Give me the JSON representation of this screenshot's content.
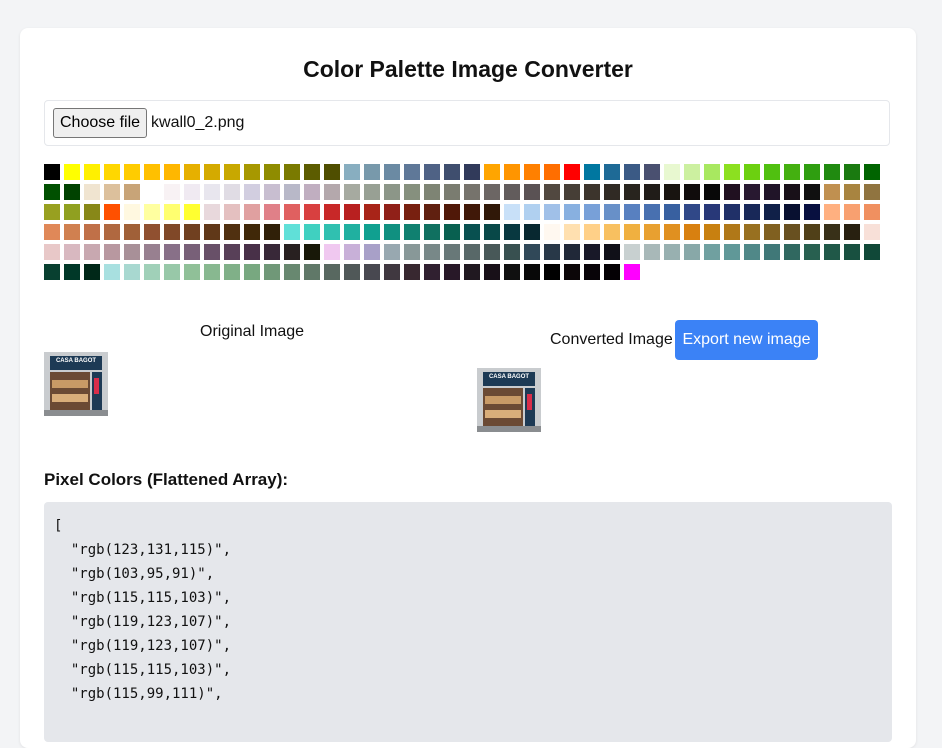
{
  "title": "Color Palette Image Converter",
  "file_input": {
    "button_label": "Choose file",
    "file_name": "kwall0_2.png"
  },
  "palette": [
    "#000000",
    "#ffff00",
    "#fff000",
    "#ffd700",
    "#ffcc00",
    "#ffc000",
    "#ffb700",
    "#e6b000",
    "#d4aa00",
    "#c8a800",
    "#a79800",
    "#8f8c00",
    "#7a7a00",
    "#5c5c00",
    "#4f4e00",
    "#88aec0",
    "#7899ab",
    "#6b8aa3",
    "#5f7898",
    "#4f6285",
    "#3f4e6e",
    "#313a5a",
    "#ffa500",
    "#ff9500",
    "#ff8000",
    "#ff6e00",
    "#ff0000",
    "#0077a0",
    "#1e6a96",
    "#3b5a85",
    "#4a5070",
    "#e8f8d0",
    "#ccf0a0",
    "#a8e860",
    "#8ce020",
    "#6cd010",
    "#50c010",
    "#44b010",
    "#2f9e10",
    "#208a10",
    "#1a7a10",
    "#006400",
    "#005000",
    "#004200",
    "#f0e4d0",
    "#dcc09c",
    "#c8a478",
    "#ffffff",
    "#f8f2f4",
    "#f0eaf2",
    "#e8e6ee",
    "#e0dce4",
    "#d2cee0",
    "#c8bed0",
    "#b8b8c8",
    "#c0aec0",
    "#b4a8ac",
    "#a6aaa0",
    "#98a094",
    "#8c9688",
    "#86907e",
    "#7e8474",
    "#7a7c70",
    "#76736c",
    "#6c6664",
    "#625c5c",
    "#5a5254",
    "#514840",
    "#463e36",
    "#3c342c",
    "#302a24",
    "#28241e",
    "#201c18",
    "#181410",
    "#100c0c",
    "#080808",
    "#201020",
    "#281830",
    "#201428",
    "#181018",
    "#101010",
    "#c09050",
    "#a88440",
    "#907440",
    "#98a020",
    "#90a020",
    "#888818",
    "#ff5000",
    "#fff8e0",
    "#ffffa0",
    "#ffff70",
    "#ffff30",
    "#e8d8dc",
    "#e4c0c0",
    "#e0a0a0",
    "#e08088",
    "#e06060",
    "#d84040",
    "#c82828",
    "#b82020",
    "#a82418",
    "#902018",
    "#782010",
    "#602010",
    "#501808",
    "#401808",
    "#301808",
    "#c8e0f8",
    "#b0d0f0",
    "#a0c0e8",
    "#88b0e0",
    "#78a0d8",
    "#6890c8",
    "#5880c0",
    "#4870b0",
    "#3860a0",
    "#304888",
    "#283878",
    "#203068",
    "#182858",
    "#102048",
    "#081030",
    "#081040",
    "#ffb080",
    "#f8a070",
    "#f09060",
    "#e08858",
    "#d08050",
    "#c07048",
    "#b06840",
    "#a06038",
    "#905030",
    "#804828",
    "#704020",
    "#603818",
    "#503010",
    "#402808",
    "#302008",
    "#60e0d8",
    "#40d0c0",
    "#30c0b0",
    "#20b0a0",
    "#10a090",
    "#109080",
    "#108070",
    "#107060",
    "#086050",
    "#085050",
    "#084848",
    "#083840",
    "#082830",
    "#fff8f0",
    "#ffe0b0",
    "#ffd088",
    "#f8c060",
    "#f0b040",
    "#e8a030",
    "#e09020",
    "#d88010",
    "#c88010",
    "#b07818",
    "#987020",
    "#806020",
    "#685020",
    "#504018",
    "#383018",
    "#282010",
    "#f8e0d8",
    "#e8c8c8",
    "#d8b8c0",
    "#c8a8b0",
    "#b898a0",
    "#a89098",
    "#988090",
    "#887088",
    "#786078",
    "#685068",
    "#584058",
    "#483048",
    "#382838",
    "#282020",
    "#181808",
    "#f0c8f0",
    "#c8b0d8",
    "#a8a0c8",
    "#98a8b0",
    "#889898",
    "#788888",
    "#687878",
    "#586868",
    "#485858",
    "#385050",
    "#304858",
    "#283848",
    "#202838",
    "#181828",
    "#101018",
    "#c8d0d0",
    "#a8b8b8",
    "#98b0b0",
    "#88a8a8",
    "#70a0a0",
    "#609898",
    "#508888",
    "#407878",
    "#306860",
    "#286050",
    "#205848",
    "#185040",
    "#104838",
    "#084030",
    "#003828",
    "#002818",
    "#a8e0e0",
    "#a8d8d0",
    "#a0d0b8",
    "#98c8a8",
    "#90c098",
    "#88b890",
    "#80b088",
    "#78a880",
    "#709878",
    "#688870",
    "#607868",
    "#586860",
    "#505858",
    "#484850",
    "#403840",
    "#382830",
    "#302030",
    "#281828",
    "#201820",
    "#181018",
    "#101010",
    "#080808",
    "#000000",
    "#0c0608",
    "#080408",
    "#040004",
    "#ff00ff"
  ],
  "original": {
    "label": "Original Image",
    "thumb_sign": "CASA BAGOT"
  },
  "converted": {
    "label": "Converted Image",
    "thumb_sign": "CASA BAGOT",
    "export_label": "Export new image"
  },
  "pixels": {
    "heading": "Pixel Colors (Flattened Array):",
    "values": [
      "rgb(123,131,115)",
      "rgb(103,95,91)",
      "rgb(115,115,103)",
      "rgb(119,123,107)",
      "rgb(119,123,107)",
      "rgb(115,115,103)",
      "rgb(115,99,111)"
    ]
  }
}
